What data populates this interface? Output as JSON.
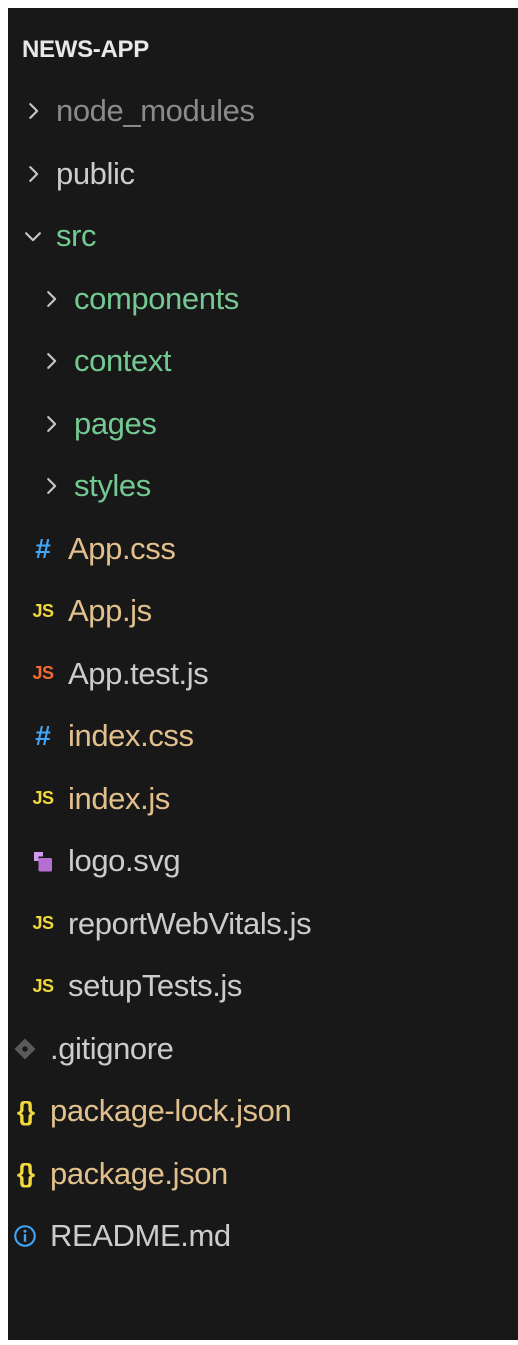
{
  "explorer": {
    "title": "NEWS-APP",
    "items": [
      {
        "label": "node_modules",
        "kind": "folder",
        "state": "collapsed",
        "indent": 0,
        "color": "#8a8a8a"
      },
      {
        "label": "public",
        "kind": "folder",
        "state": "collapsed",
        "indent": 0,
        "color": "#cccccc"
      },
      {
        "label": "src",
        "kind": "folder",
        "state": "expanded",
        "indent": 0,
        "color": "#73c991"
      },
      {
        "label": "components",
        "kind": "folder",
        "state": "collapsed",
        "indent": 1,
        "color": "#73c991"
      },
      {
        "label": "context",
        "kind": "folder",
        "state": "collapsed",
        "indent": 1,
        "color": "#73c991"
      },
      {
        "label": "pages",
        "kind": "folder",
        "state": "collapsed",
        "indent": 1,
        "color": "#73c991"
      },
      {
        "label": "styles",
        "kind": "folder",
        "state": "collapsed",
        "indent": 1,
        "color": "#73c991"
      },
      {
        "label": "App.css",
        "kind": "file",
        "icon": "css-hash-icon",
        "icon_glyph": "#",
        "icon_color": "#42a5f5",
        "indent": 1,
        "color": "#e2c08d"
      },
      {
        "label": "App.js",
        "kind": "file",
        "icon": "js-icon",
        "icon_glyph": "JS",
        "icon_color": "#f1d83b",
        "indent": 1,
        "color": "#e2c08d"
      },
      {
        "label": "App.test.js",
        "kind": "file",
        "icon": "js-test-icon",
        "icon_glyph": "JS",
        "icon_color": "#f26b2f",
        "indent": 1,
        "color": "#cccccc"
      },
      {
        "label": "index.css",
        "kind": "file",
        "icon": "css-hash-icon",
        "icon_glyph": "#",
        "icon_color": "#42a5f5",
        "indent": 1,
        "color": "#e2c08d"
      },
      {
        "label": "index.js",
        "kind": "file",
        "icon": "js-icon",
        "icon_glyph": "JS",
        "icon_color": "#f1d83b",
        "indent": 1,
        "color": "#e2c08d"
      },
      {
        "label": "logo.svg",
        "kind": "file",
        "icon": "svg-icon",
        "icon_glyph": "",
        "icon_color": "#b46fd1",
        "indent": 1,
        "color": "#cccccc"
      },
      {
        "label": "reportWebVitals.js",
        "kind": "file",
        "icon": "js-icon",
        "icon_glyph": "JS",
        "icon_color": "#f1d83b",
        "indent": 1,
        "color": "#cccccc"
      },
      {
        "label": "setupTests.js",
        "kind": "file",
        "icon": "js-icon",
        "icon_glyph": "JS",
        "icon_color": "#f1d83b",
        "indent": 1,
        "color": "#cccccc"
      },
      {
        "label": ".gitignore",
        "kind": "file",
        "icon": "git-icon",
        "icon_glyph": "",
        "icon_color": "#5a5a5a",
        "indent": 0,
        "color": "#cccccc"
      },
      {
        "label": "package-lock.json",
        "kind": "file",
        "icon": "json-braces-icon",
        "icon_glyph": "{}",
        "icon_color": "#f1d83b",
        "indent": 0,
        "color": "#e2c08d"
      },
      {
        "label": "package.json",
        "kind": "file",
        "icon": "json-braces-icon",
        "icon_glyph": "{}",
        "icon_color": "#f1d83b",
        "indent": 0,
        "color": "#e2c08d"
      },
      {
        "label": "README.md",
        "kind": "file",
        "icon": "info-icon",
        "icon_glyph": "",
        "icon_color": "#42a5f5",
        "indent": 0,
        "color": "#cccccc"
      }
    ]
  }
}
